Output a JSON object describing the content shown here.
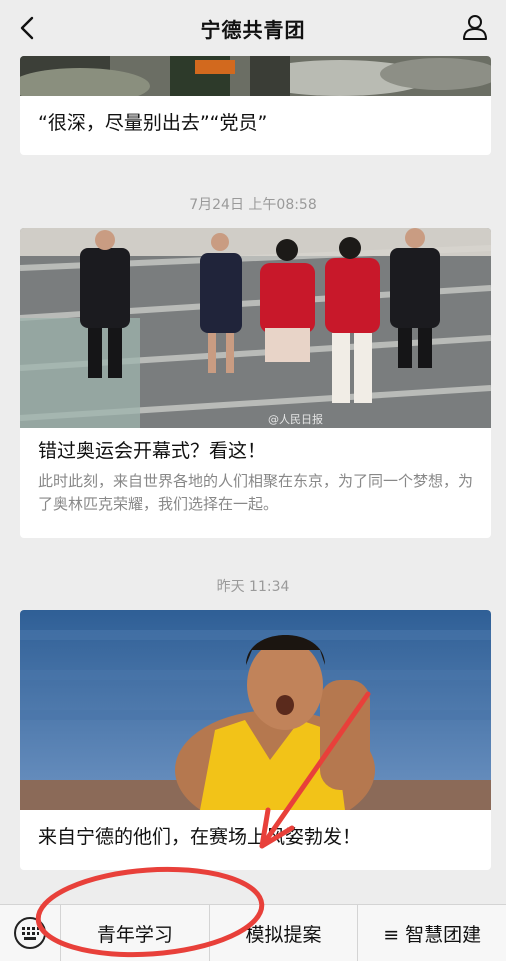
{
  "header": {
    "title": "宁德共青团"
  },
  "messages": [
    {
      "caption": "“很深，尽量别出去”“党员”"
    },
    {
      "time": "7月24日 上午08:58",
      "caption": "错过奥运会开幕式？看这！",
      "description": "此时此刻，来自世界各地的人们相聚在东京，为了同一个梦想，为了奥林匹克荣耀，我们选择在一起。",
      "watermark": "@人民日报"
    },
    {
      "time": "昨天 11:34",
      "caption": "来自宁德的他们，在赛场上风姿勃发！"
    }
  ],
  "bottom_menu": {
    "items": [
      {
        "label": "青年学习"
      },
      {
        "label": "模拟提案"
      },
      {
        "label": "≡ 智慧团建"
      }
    ]
  },
  "colors": {
    "annotation": "#e8403a",
    "background": "#ededed"
  }
}
